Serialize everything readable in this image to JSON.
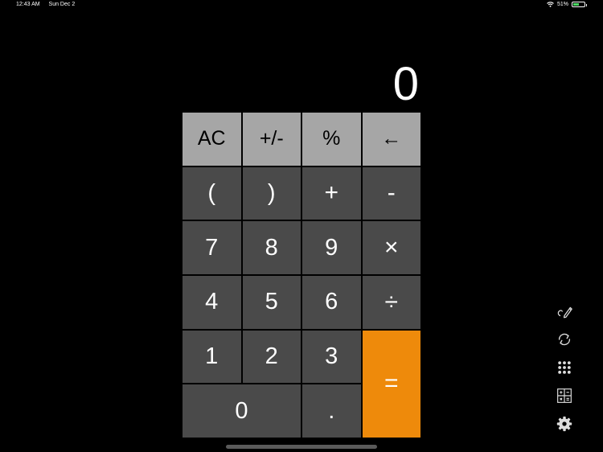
{
  "status_bar": {
    "time": "12:43 AM",
    "date": "Sun Dec 2",
    "battery_percent": "51%",
    "battery_level": 0.51
  },
  "display": {
    "value": "0"
  },
  "keypad": {
    "ac": "AC",
    "plus_minus": "+/-",
    "percent": "%",
    "backspace": "←",
    "open_paren": "(",
    "close_paren": ")",
    "plus": "+",
    "minus": "-",
    "seven": "7",
    "eight": "8",
    "nine": "9",
    "multiply": "×",
    "four": "4",
    "five": "5",
    "six": "6",
    "divide": "÷",
    "one": "1",
    "two": "2",
    "three": "3",
    "equals": "=",
    "zero": "0",
    "decimal": "."
  },
  "side_toolbar": {
    "icons": [
      "handwriting-icon",
      "convert-icon",
      "keypad-icon",
      "scientific-icon",
      "settings-icon"
    ]
  },
  "colors": {
    "background": "#000000",
    "function_key": "#a6a6a6",
    "number_key": "#4a4a4a",
    "equals_key": "#ee8a0b",
    "battery": "#4cd964"
  }
}
